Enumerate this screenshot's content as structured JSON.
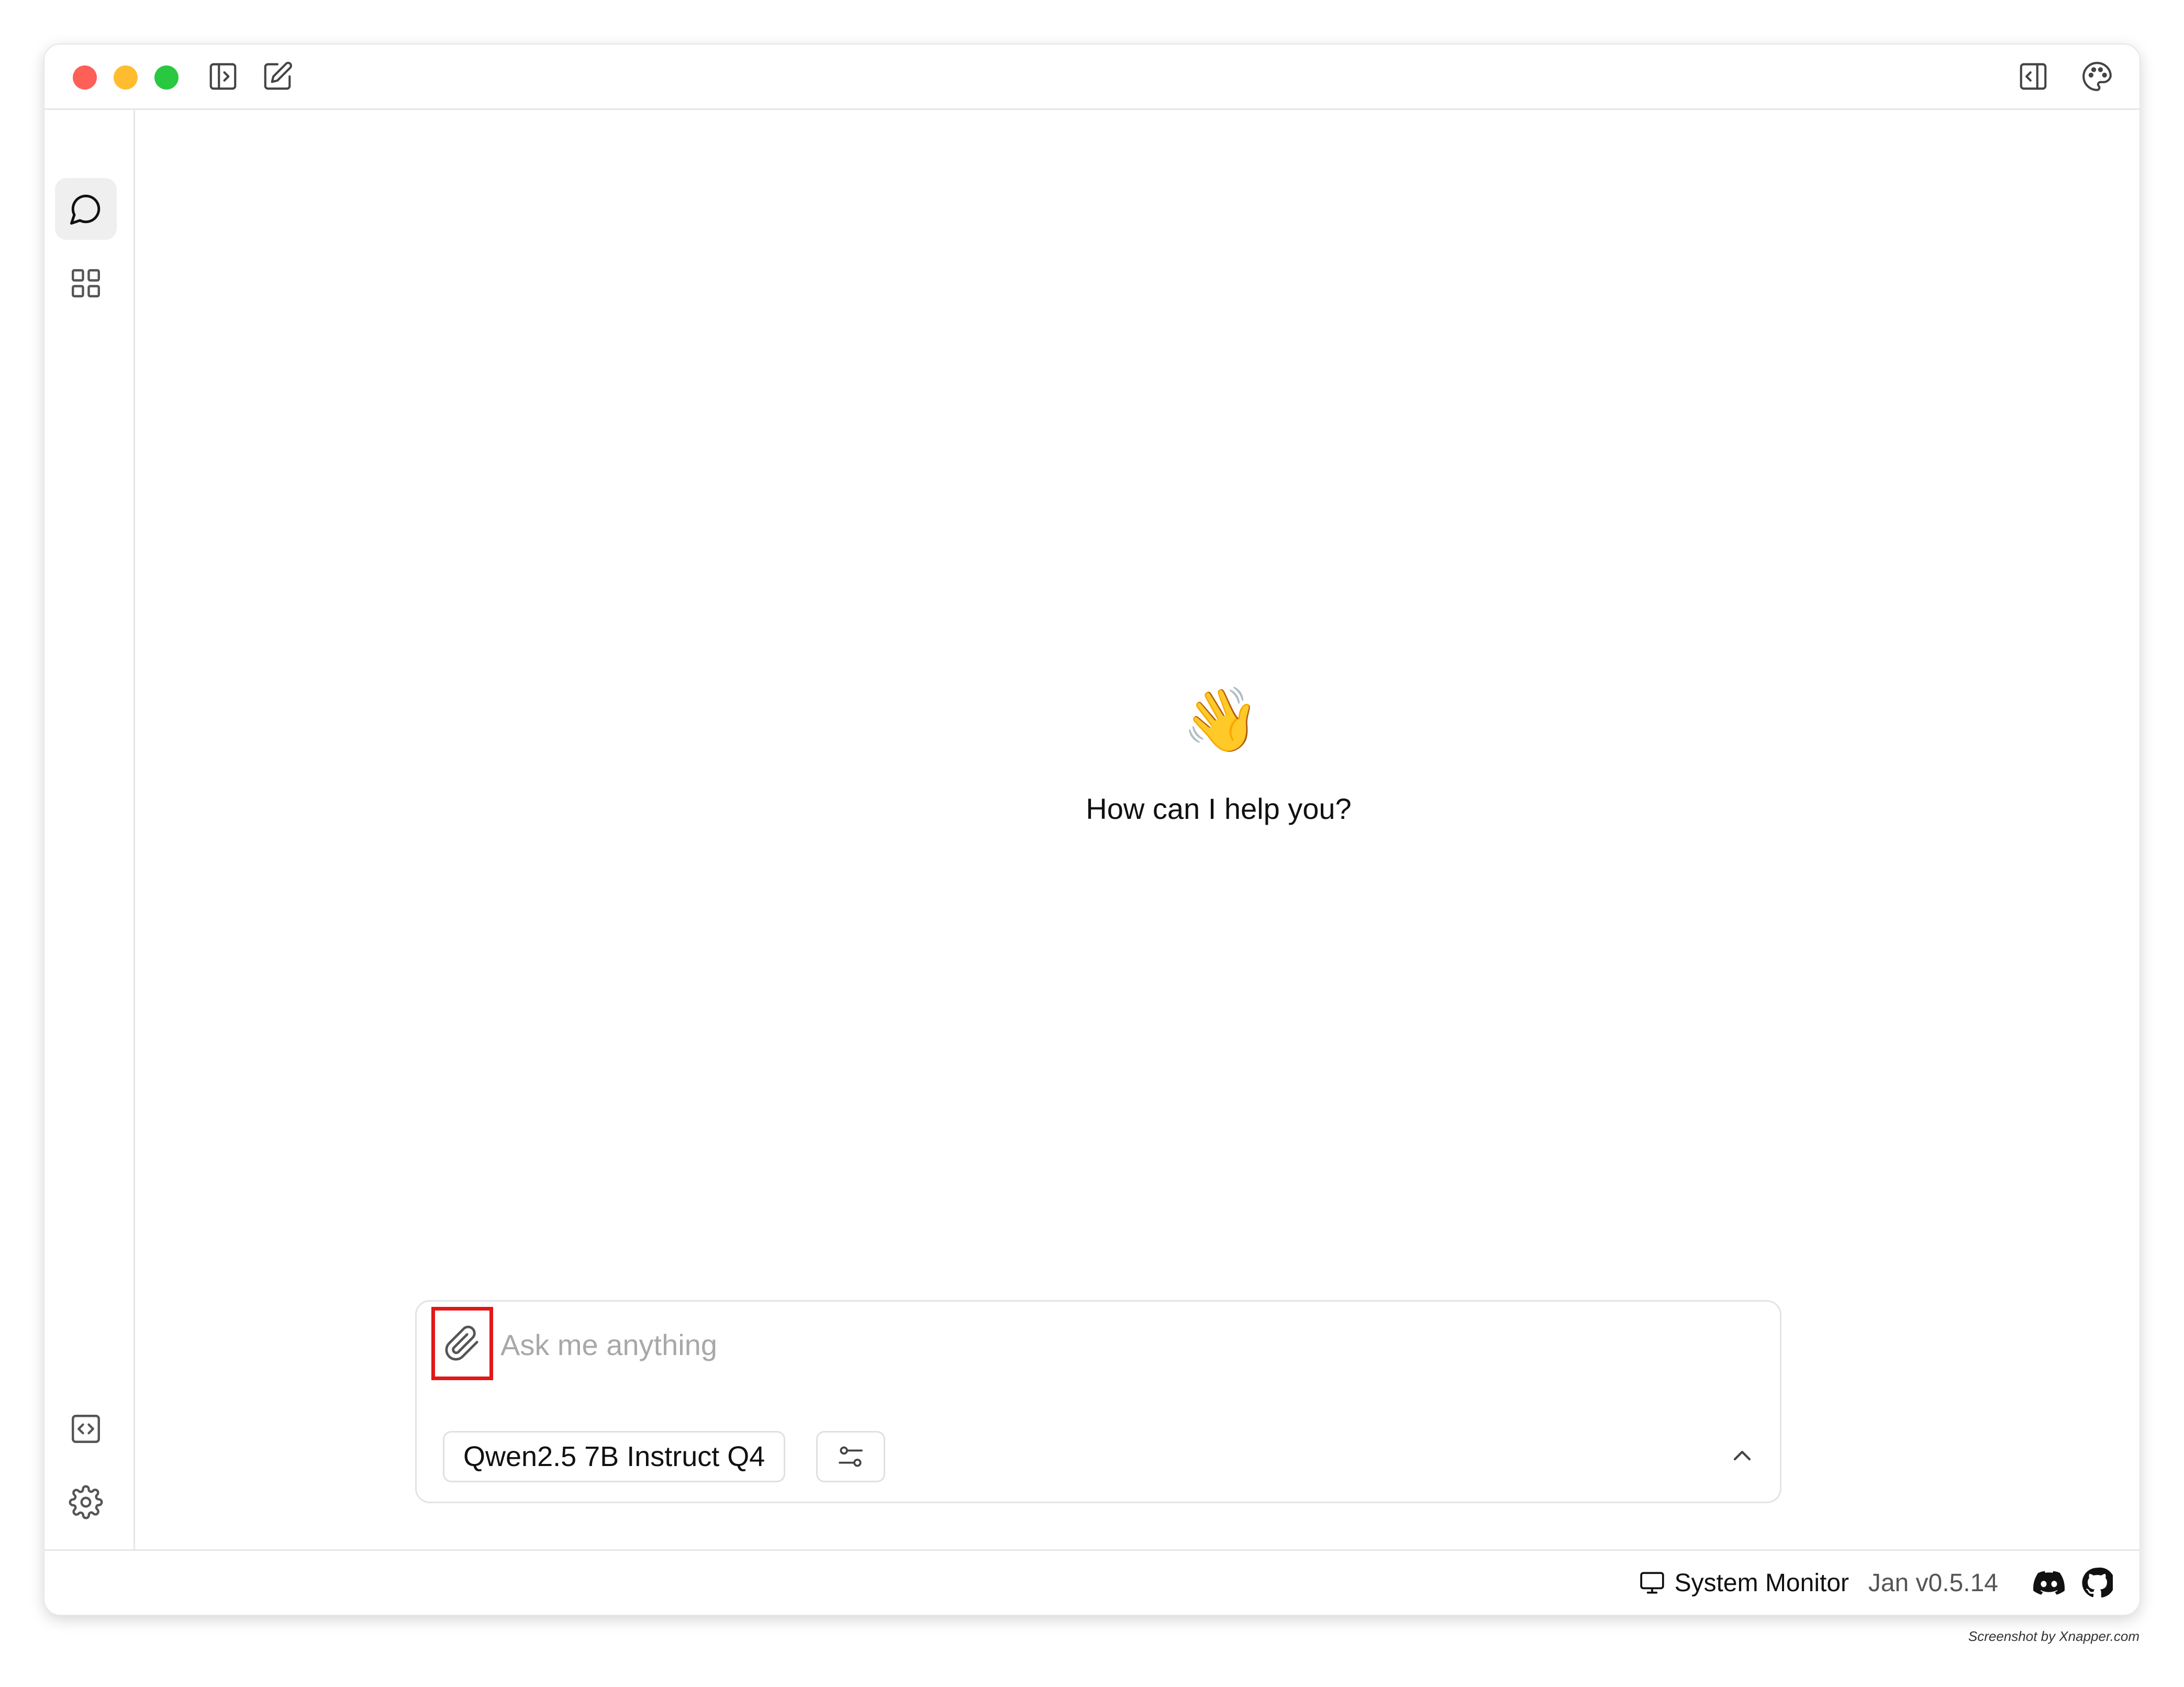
{
  "main": {
    "greeting_emoji": "👋",
    "greeting_text": "How can I help you?"
  },
  "composer": {
    "placeholder": "Ask me anything",
    "model_label": "Qwen2.5 7B Instruct Q4"
  },
  "status_bar": {
    "system_monitor_label": "System Monitor",
    "version": "Jan v0.5.14"
  },
  "watermark": "Screenshot by Xnapper.com",
  "icons": {
    "titlebar_left": [
      "sidebar-toggle-icon",
      "new-thread-icon"
    ],
    "titlebar_right": [
      "right-panel-toggle-icon",
      "palette-icon"
    ],
    "rail_top": [
      "chat-bubble-icon",
      "grid-icon"
    ],
    "rail_bottom": [
      "code-icon",
      "gear-icon"
    ],
    "composer": [
      "paperclip-icon",
      "sliders-icon",
      "chevron-up-icon"
    ],
    "status": [
      "monitor-icon",
      "discord-icon",
      "github-icon"
    ]
  },
  "colors": {
    "traffic_red": "#fe5f57",
    "traffic_yellow": "#febc2e",
    "traffic_green": "#28c840",
    "highlight_border": "#e01818",
    "placeholder_text": "#a8a8a8"
  }
}
